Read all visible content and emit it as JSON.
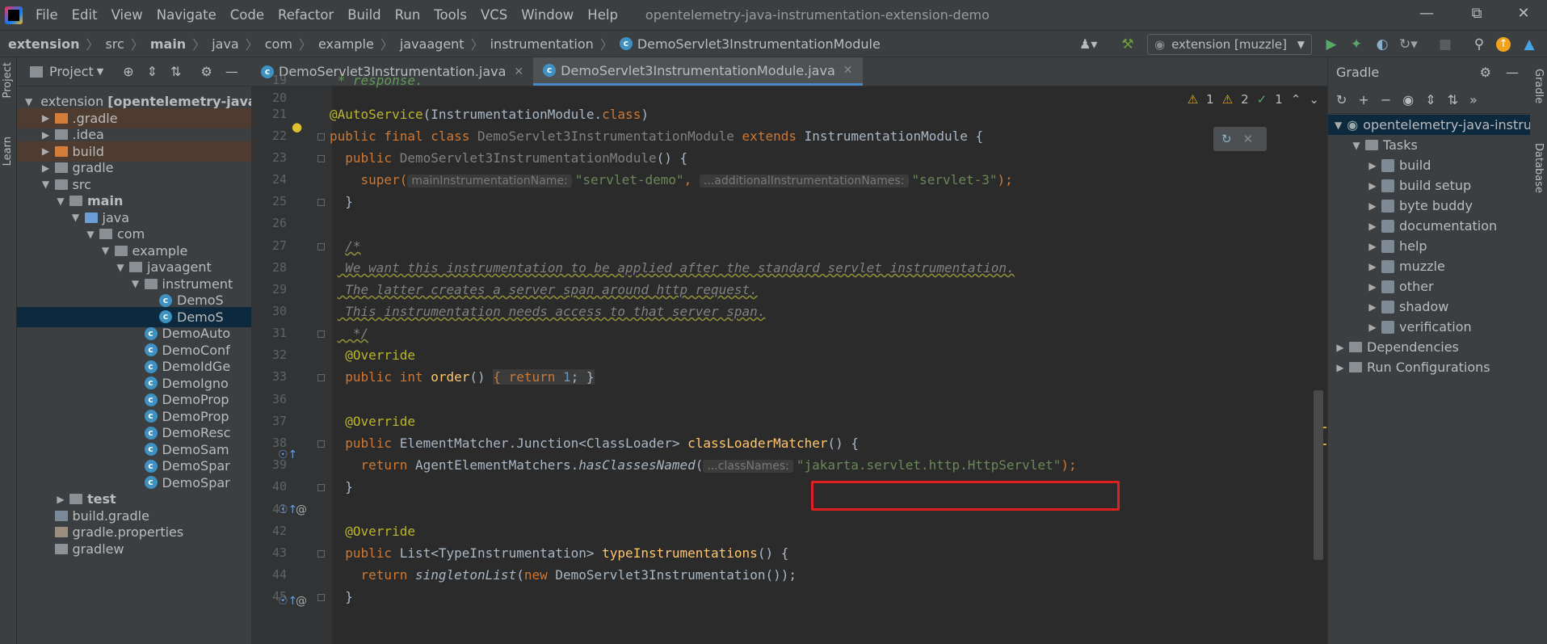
{
  "menubar": {
    "items": [
      "File",
      "Edit",
      "View",
      "Navigate",
      "Code",
      "Refactor",
      "Build",
      "Run",
      "Tools",
      "VCS",
      "Window",
      "Help"
    ],
    "title": "opentelemetry-java-instrumentation-extension-demo"
  },
  "breadcrumbs": [
    "extension",
    "src",
    "main",
    "java",
    "com",
    "example",
    "javaagent",
    "instrumentation",
    "DemoServlet3InstrumentationModule"
  ],
  "run_config": "extension [muzzle]",
  "side_tabs": {
    "project": "Project",
    "learn": "Learn",
    "gradle": "Gradle",
    "database": "Database"
  },
  "project_panel": {
    "title": "Project",
    "tree": [
      {
        "label": "extension",
        "suffix": "[opentelemetry-java",
        "kind": "module"
      },
      {
        "label": ".gradle",
        "kind": "folder-orange"
      },
      {
        "label": ".idea",
        "kind": "folder"
      },
      {
        "label": "build",
        "kind": "folder-orange"
      },
      {
        "label": "gradle",
        "kind": "folder"
      },
      {
        "label": "src",
        "kind": "folder"
      },
      {
        "label": "main",
        "kind": "folder"
      },
      {
        "label": "java",
        "kind": "folder-blue"
      },
      {
        "label": "com",
        "kind": "folder"
      },
      {
        "label": "example",
        "kind": "folder"
      },
      {
        "label": "javaagent",
        "kind": "folder"
      },
      {
        "label": "instrument",
        "kind": "folder"
      },
      {
        "label": "DemoS",
        "kind": "class"
      },
      {
        "label": "DemoS",
        "kind": "class"
      },
      {
        "label": "DemoAuto",
        "kind": "class"
      },
      {
        "label": "DemoConf",
        "kind": "class"
      },
      {
        "label": "DemoIdGe",
        "kind": "class"
      },
      {
        "label": "DemoIgno",
        "kind": "class"
      },
      {
        "label": "DemoProp",
        "kind": "class"
      },
      {
        "label": "DemoProp",
        "kind": "class"
      },
      {
        "label": "DemoResc",
        "kind": "class"
      },
      {
        "label": "DemoSam",
        "kind": "class"
      },
      {
        "label": "DemoSpar",
        "kind": "class"
      },
      {
        "label": "DemoSpar",
        "kind": "class"
      },
      {
        "label": "test",
        "kind": "folder"
      },
      {
        "label": "build.gradle",
        "kind": "gradle"
      },
      {
        "label": "gradle.properties",
        "kind": "props"
      },
      {
        "label": "gradlew",
        "kind": "file"
      }
    ]
  },
  "editor": {
    "tabs": [
      {
        "label": "DemoServlet3Instrumentation.java",
        "active": false
      },
      {
        "label": "DemoServlet3InstrumentationModule.java",
        "active": true
      }
    ],
    "inspections": {
      "warn1": "1",
      "warn2": "2",
      "ok": "1"
    },
    "line_numbers": [
      "19",
      "20",
      "21",
      "22",
      "23",
      "24",
      "25",
      "26",
      "27",
      "28",
      "29",
      "30",
      "31",
      "32",
      "33",
      "36",
      "37",
      "38",
      "39",
      "40",
      "41",
      "42",
      "43",
      "44",
      "45"
    ],
    "lines": {
      "l19": " * response.",
      "l21_ann": "@AutoService",
      "l21_rest": "(InstrumentationModule.",
      "l21_kw": "class",
      "l21_end": ")",
      "l22_kw": "public final class ",
      "l22_name": "DemoServlet3InstrumentationModule ",
      "l22_ext": "extends ",
      "l22_rest": "InstrumentationModule {",
      "l23_kw": "public ",
      "l23_name": "DemoServlet3InstrumentationModule",
      "l23_rest": "() {",
      "l24_fn": "super(",
      "l24_hint1": "mainInstrumentationName:",
      "l24_str1": "\"servlet-demo\"",
      "l24_comma": ", ",
      "l24_hint2": "...additionalInstrumentationNames:",
      "l24_str2": "\"servlet-3\"",
      "l24_end": ");",
      "l25": "}",
      "l27": "/*",
      "l28": " We want this instrumentation to be applied after the standard servlet instrumentation.",
      "l29": " The latter creates a server span around http request.",
      "l30": " This instrumentation needs access to that server span.",
      "l31": "  */",
      "l32": "@Override",
      "l33_kw": "public int ",
      "l33_fn": "order",
      "l33_paren": "() ",
      "l33_body_kw": "{ return ",
      "l33_num": "1",
      "l33_end": "; }",
      "l37": "@Override",
      "l38_kw": "public ",
      "l38_type": "ElementMatcher.Junction<ClassLoader> ",
      "l38_fn": "classLoaderMatcher",
      "l38_end": "() {",
      "l39_kw": "return ",
      "l39_obj": "AgentElementMatchers.",
      "l39_fn": "hasClassesNamed",
      "l39_paren": "(",
      "l39_hint": "...classNames:",
      "l39_str": "\"jakarta.servlet.http.HttpServlet\"",
      "l39_end": ");",
      "l40": "}",
      "l42": "@Override",
      "l43_kw": "public ",
      "l43_type": "List<TypeInstrumentation> ",
      "l43_fn": "typeInstrumentations",
      "l43_end": "() {",
      "l44_kw": "return ",
      "l44_fn": "singletonList",
      "l44_paren": "(",
      "l44_new": "new ",
      "l44_rest": "DemoServlet3Instrumentation());",
      "l45": "}"
    }
  },
  "gradle_panel": {
    "title": "Gradle",
    "root": "opentelemetry-java-instru",
    "tasks_label": "Tasks",
    "tasks": [
      "build",
      "build setup",
      "byte buddy",
      "documentation",
      "help",
      "muzzle",
      "other",
      "shadow",
      "verification"
    ],
    "dependencies": "Dependencies",
    "run_configurations": "Run Configurations"
  }
}
